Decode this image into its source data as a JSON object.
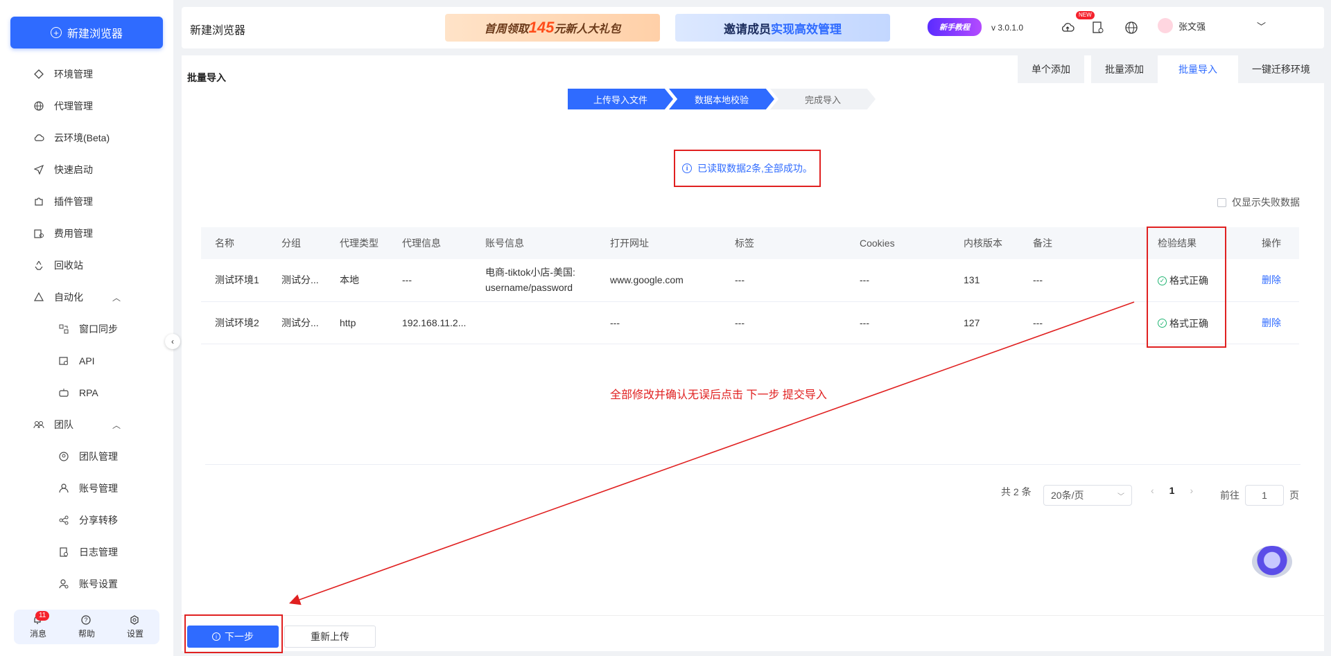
{
  "sidebar": {
    "new_browser": "新建浏览器",
    "items": [
      {
        "label": "环境管理",
        "icon": "env-icon"
      },
      {
        "label": "代理管理",
        "icon": "globe-icon"
      },
      {
        "label": "云环境(Beta)",
        "icon": "cloud-icon"
      },
      {
        "label": "快速启动",
        "icon": "send-icon"
      },
      {
        "label": "插件管理",
        "icon": "puzzle-icon"
      },
      {
        "label": "费用管理",
        "icon": "billing-icon"
      },
      {
        "label": "回收站",
        "icon": "recycle-icon"
      },
      {
        "label": "自动化",
        "icon": "automation-icon"
      },
      {
        "label": "窗口同步",
        "icon": "window-sync-icon"
      },
      {
        "label": "API",
        "icon": "api-icon"
      },
      {
        "label": "RPA",
        "icon": "robot-icon"
      },
      {
        "label": "团队",
        "icon": "team-icon"
      },
      {
        "label": "团队管理",
        "icon": "team-manage-icon"
      },
      {
        "label": "账号管理",
        "icon": "user-icon"
      },
      {
        "label": "分享转移",
        "icon": "share-icon"
      },
      {
        "label": "日志管理",
        "icon": "log-icon"
      },
      {
        "label": "账号设置",
        "icon": "user-settings-icon"
      }
    ],
    "bottom": {
      "messages": "消息",
      "messages_badge": "11",
      "help": "帮助",
      "settings": "设置"
    }
  },
  "header": {
    "title": "新建浏览器",
    "banner1_pre": "首周领取",
    "banner1_num": "145",
    "banner1_post": "元新人大礼包",
    "banner2_pre": "邀请成员",
    "banner2_hl": "实现高效管理",
    "guide": "新手教程",
    "version": "v 3.0.1.0",
    "new_tag": "NEW",
    "username": "张文强"
  },
  "main": {
    "page_label": "批量导入",
    "tabs": [
      "单个添加",
      "批量添加",
      "批量导入",
      "一键迁移环境"
    ],
    "steps": [
      "上传导入文件",
      "数据本地校验",
      "完成导入"
    ],
    "alert": "已读取数据2条,全部成功。",
    "only_fail": "仅显示失败数据",
    "columns": [
      "名称",
      "分组",
      "代理类型",
      "代理信息",
      "账号信息",
      "打开网址",
      "标签",
      "Cookies",
      "内核版本",
      "备注",
      "检验结果",
      "操作"
    ],
    "rows": [
      {
        "name": "测试环境1",
        "group": "测试分...",
        "proxy_type": "本地",
        "proxy_info": "---",
        "account_1": "电商-tiktok小店-美国:",
        "account_2": "username/password",
        "url": "www.google.com",
        "tag": "---",
        "cookies": "---",
        "kernel": "131",
        "note": "---",
        "result": "格式正确",
        "action": "删除"
      },
      {
        "name": "测试环境2",
        "group": "测试分...",
        "proxy_type": "http",
        "proxy_info": "192.168.11.2...",
        "account_1": "",
        "account_2": "",
        "url": "---",
        "tag": "---",
        "cookies": "---",
        "kernel": "127",
        "note": "---",
        "result": "格式正确",
        "action": "删除"
      }
    ],
    "instruction": "全部修改并确认无误后点击 下一步 提交导入",
    "pager": {
      "total": "共 2 条",
      "page_size": "20条/页",
      "current": "1",
      "goto_label": "前往",
      "goto_value": "1",
      "page_suffix": "页"
    }
  },
  "footer": {
    "next": "下一步",
    "reupload": "重新上传"
  },
  "colors": {
    "primary": "#2f6bff",
    "annotation": "#e02020",
    "success": "#22b573"
  }
}
